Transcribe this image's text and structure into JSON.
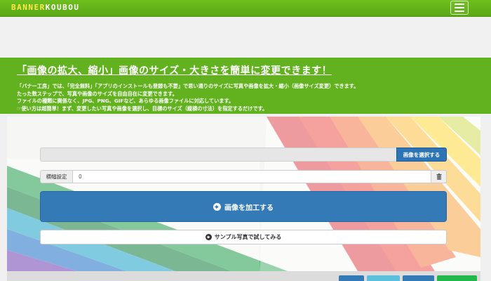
{
  "navbar": {
    "brand_part1": "BANNER",
    "brand_part2": "KOUBOU",
    "menu_icon": "hamburger-icon",
    "brand_color_1": "#ffe94a",
    "brand_color_2": "#ffffff",
    "bar_color": "#62b11f"
  },
  "hero": {
    "title": "「画像の拡大、縮小」画像のサイズ・大きさを簡単に変更できます！",
    "lines": [
      "「バナー工房」では、「完全無料」「アプリのインストールも登録も不要」で思い通りのサイズに写真や画像を拡大・縮小（画像サイズ変更）できます。",
      "たった数ステップで、写真や画像のサイズを自由自在に変更できます。",
      "ファイルの種類に関係なく、JPG、PNG、GIFなど、あらゆる画像ファイルに対応しています。",
      "使い方は超簡単！まず、変更したい写真や画像を選択し、目標のサイズ（縦横の寸法）を指定するだけです。"
    ]
  },
  "form": {
    "file_input_value": "",
    "file_button_label": "画像を選択する",
    "width_label": "横幅設定",
    "width_value": "0",
    "trash_icon": "trash-icon",
    "process_icon": "arrow-circle-right-icon",
    "process_button_label": "画像を加工する",
    "sample_icon": "arrow-circle-right-icon",
    "sample_button_label": "サンプル写真で試してみる",
    "primary_color": "#337ab7"
  },
  "bottom_buttons": [
    {
      "color": "#337ab7"
    },
    {
      "color": "#5bc0de"
    },
    {
      "color": "#337ab7"
    },
    {
      "color": "#22b84a"
    }
  ]
}
